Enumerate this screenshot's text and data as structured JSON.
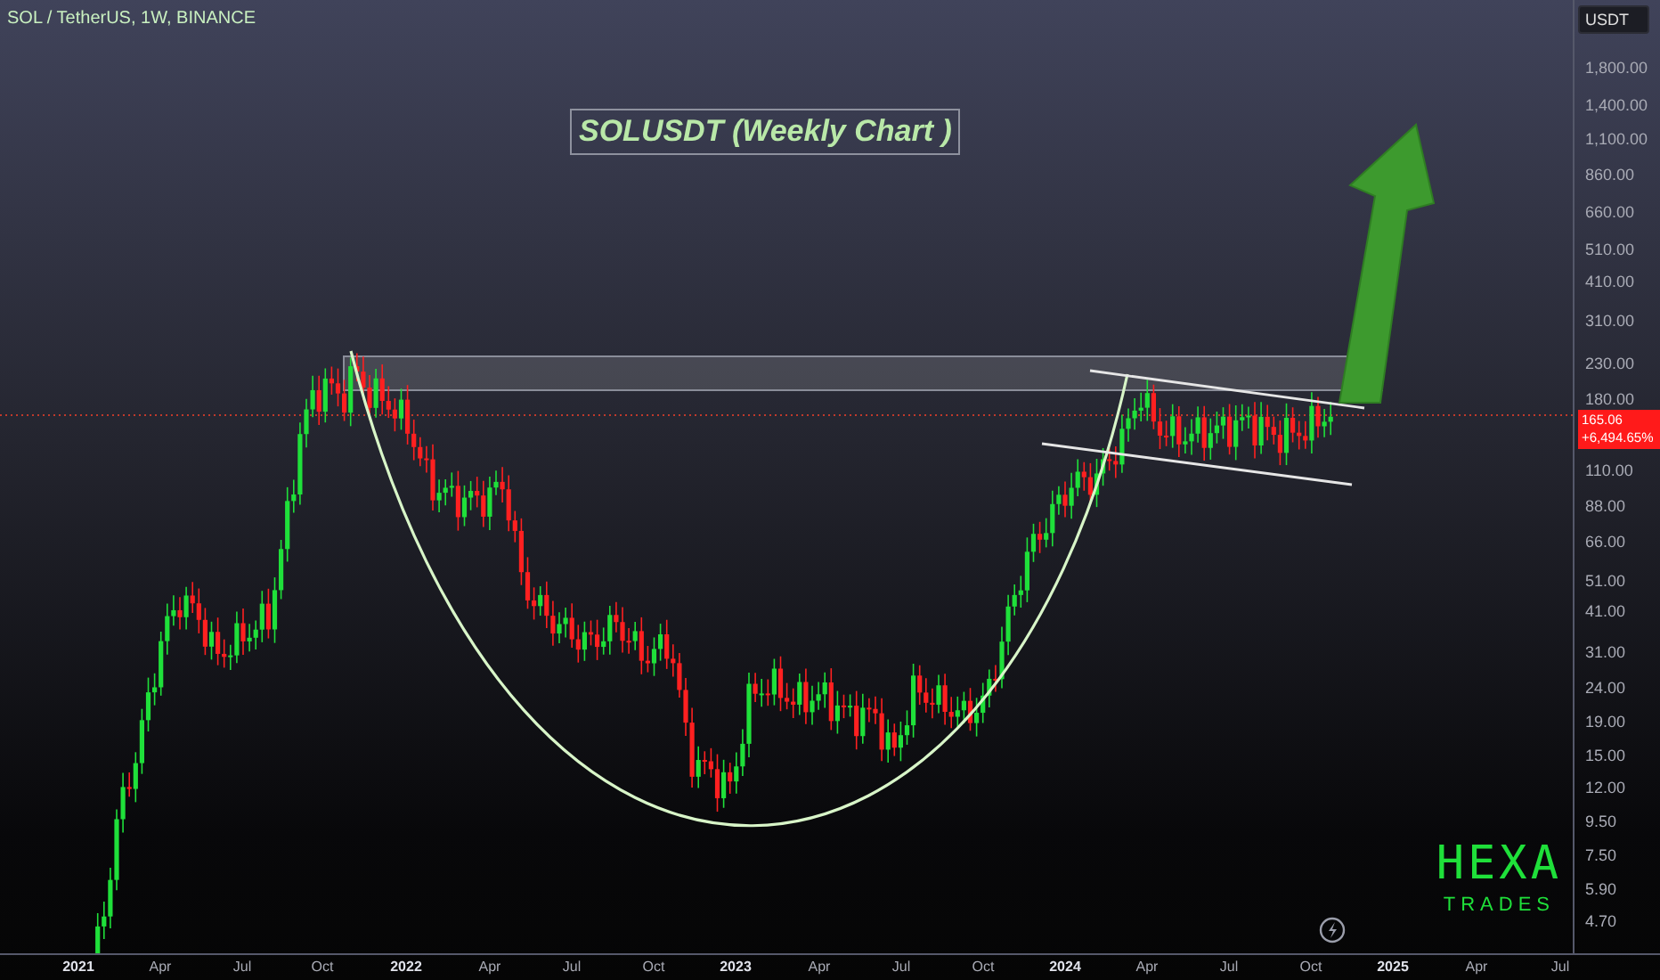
{
  "header": "SOL / TetherUS, 1W, BINANCE",
  "title": "SOLUSDT (Weekly Chart )",
  "price_axis": {
    "currency": "USDT",
    "labels": [
      "1,800.00",
      "1,400.00",
      "1,100.00",
      "860.00",
      "660.00",
      "510.00",
      "410.00",
      "310.00",
      "230.00",
      "180.00",
      "110.00",
      "88.00",
      "66.00",
      "51.00",
      "41.00",
      "31.00",
      "24.00",
      "19.00",
      "15.00",
      "12.00",
      "9.50",
      "7.50",
      "5.90",
      "4.70"
    ],
    "last_price": "165.06",
    "change": "+6,494.65%"
  },
  "time_axis": [
    {
      "text": "2021",
      "kind": "year"
    },
    {
      "text": "Apr",
      "kind": "month"
    },
    {
      "text": "Jul",
      "kind": "month"
    },
    {
      "text": "Oct",
      "kind": "month"
    },
    {
      "text": "2022",
      "kind": "year"
    },
    {
      "text": "Apr",
      "kind": "month"
    },
    {
      "text": "Jul",
      "kind": "month"
    },
    {
      "text": "Oct",
      "kind": "month"
    },
    {
      "text": "2023",
      "kind": "year"
    },
    {
      "text": "Apr",
      "kind": "month"
    },
    {
      "text": "Jul",
      "kind": "month"
    },
    {
      "text": "Oct",
      "kind": "month"
    },
    {
      "text": "2024",
      "kind": "year"
    },
    {
      "text": "Apr",
      "kind": "month"
    },
    {
      "text": "Jul",
      "kind": "month"
    },
    {
      "text": "Oct",
      "kind": "month"
    },
    {
      "text": "2025",
      "kind": "year"
    },
    {
      "text": "Apr",
      "kind": "month"
    },
    {
      "text": "Jul",
      "kind": "month"
    }
  ],
  "logo": {
    "line1": "HEXA",
    "line2": "TRADES"
  }
}
